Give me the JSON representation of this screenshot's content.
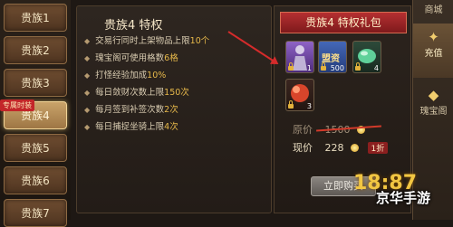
{
  "sidebar": {
    "items": [
      {
        "label": "贵族1"
      },
      {
        "label": "贵族2"
      },
      {
        "label": "贵族3"
      },
      {
        "label": "贵族4"
      },
      {
        "label": "贵族5"
      },
      {
        "label": "贵族6"
      },
      {
        "label": "贵族7"
      }
    ],
    "active_index": 3,
    "badge": "专属时装"
  },
  "privileges": {
    "title": "贵族4 特权",
    "items": [
      {
        "pre": "交易行同时上架物品上限",
        "hl": "10个",
        "post": ""
      },
      {
        "pre": "瑰宝阁可使用格数",
        "hl": "6格",
        "post": ""
      },
      {
        "pre": "打怪经验加成",
        "hl": "10%",
        "post": ""
      },
      {
        "pre": "每日敛财次数上限",
        "hl": "150次",
        "post": ""
      },
      {
        "pre": "每月签到补签次数",
        "hl": "2次",
        "post": ""
      },
      {
        "pre": "每日捕捉坐骑上限",
        "hl": "4次",
        "post": ""
      }
    ]
  },
  "gift": {
    "title": "贵族4 特权礼包",
    "slots": [
      {
        "icon": "fashion-icon",
        "qty": "1",
        "color": "#7b4fb5"
      },
      {
        "icon": "token-icon",
        "label": "盟资",
        "qty": "500",
        "color": "#3558a8"
      },
      {
        "icon": "gem-icon",
        "qty": "4",
        "color": "#2b7a5a"
      },
      {
        "icon": "orb-icon",
        "qty": "3",
        "color": "#b0361f"
      }
    ],
    "original_price_label": "原价",
    "original_price": "1500",
    "current_price_label": "现价",
    "current_price": "228",
    "discount": "1折",
    "buy_label": "立即购买"
  },
  "tabs": [
    {
      "label": "商城",
      "icon": ""
    },
    {
      "label": "充值",
      "icon": "✦"
    },
    {
      "label": "瑰宝阁",
      "icon": "◆"
    }
  ],
  "watermark": {
    "logo": "18:87",
    "text": "京华手游"
  },
  "colors": {
    "accent": "#e6b84a",
    "banner": "#b53031"
  }
}
